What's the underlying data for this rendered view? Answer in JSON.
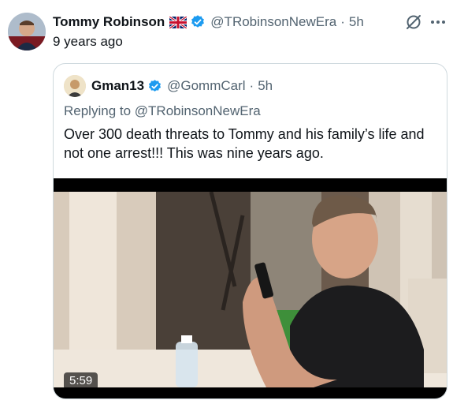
{
  "tweet": {
    "author_name": "Tommy Robinson",
    "handle": "@TRobinsonNewEra",
    "time": "5h",
    "separator": "·",
    "text": "9 years ago",
    "flag_icon": "uk-flag-icon",
    "verified_icon": "verified-badge-icon",
    "verified_color": "#1d9bf0"
  },
  "quoted_tweet": {
    "author_name": "Gman13",
    "handle": "@GommCarl",
    "time": "5h",
    "separator": "·",
    "replying_prefix": "Replying to ",
    "replying_to": "@TRobinsonNewEra",
    "text": "Over 300 death threats to Tommy and his family’s life and not one arrest!!! This was nine years ago.",
    "video": {
      "duration": "5:59"
    }
  },
  "actions": {
    "grok_icon": "grok-icon",
    "more_icon": "more-options-icon"
  }
}
